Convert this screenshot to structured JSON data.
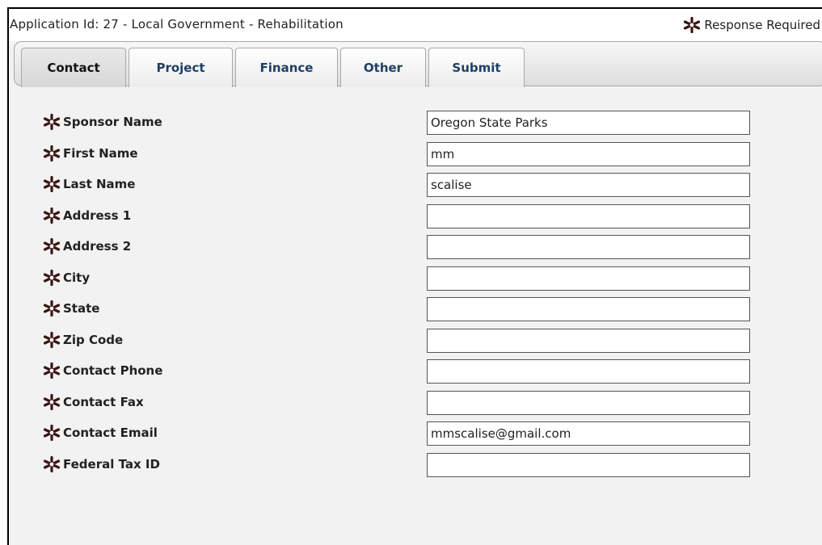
{
  "header": {
    "application_title": "Application Id: 27 - Local Government - Rehabilitation",
    "required_legend": "Response Required"
  },
  "tabs": [
    {
      "label": "Contact",
      "active": true
    },
    {
      "label": "Project",
      "active": false
    },
    {
      "label": "Finance",
      "active": false
    },
    {
      "label": "Other",
      "active": false
    },
    {
      "label": "Submit",
      "active": false
    }
  ],
  "icons": {
    "required": "required-asterisk-icon"
  },
  "colors": {
    "asterisk": "#3a1414",
    "tab_text": "#1f3f66",
    "panel_bg": "#f2f2f2"
  },
  "form": {
    "fields": [
      {
        "label": "Sponsor Name",
        "value": "Oregon State Parks",
        "required": true
      },
      {
        "label": "First Name",
        "value": "mm",
        "required": true
      },
      {
        "label": "Last Name",
        "value": "scalise",
        "required": true
      },
      {
        "label": "Address 1",
        "value": "",
        "required": true
      },
      {
        "label": "Address 2",
        "value": "",
        "required": true
      },
      {
        "label": "City",
        "value": "",
        "required": true
      },
      {
        "label": "State",
        "value": "",
        "required": true
      },
      {
        "label": "Zip Code",
        "value": "",
        "required": true
      },
      {
        "label": "Contact Phone",
        "value": "",
        "required": true
      },
      {
        "label": "Contact Fax",
        "value": "",
        "required": true
      },
      {
        "label": "Contact Email",
        "value": "mmscalise@gmail.com",
        "required": true
      },
      {
        "label": "Federal Tax ID",
        "value": "",
        "required": true
      }
    ]
  }
}
